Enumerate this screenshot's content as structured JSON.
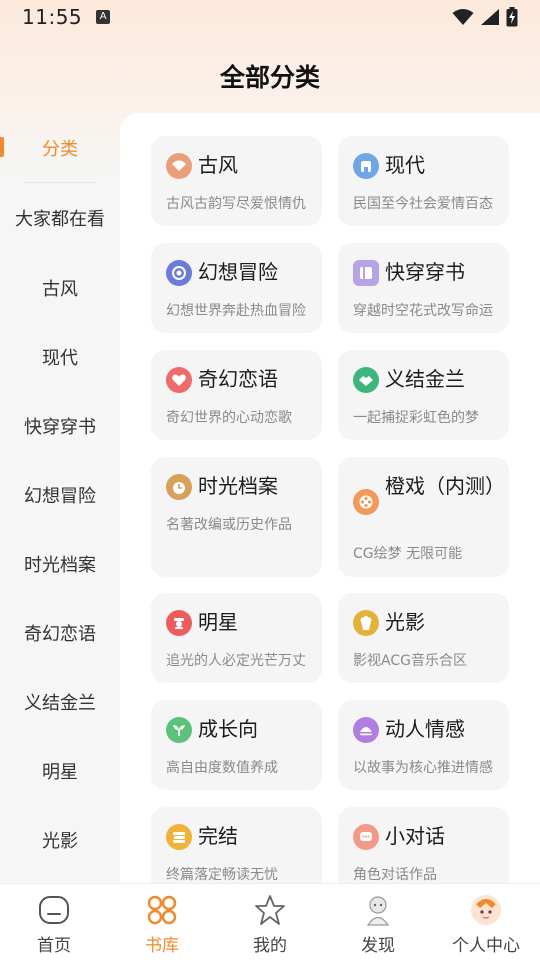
{
  "status_bar": {
    "time": "11:55",
    "notif_badge": "A"
  },
  "header": {
    "title": "全部分类"
  },
  "sidebar": {
    "items": [
      {
        "label": "分类"
      },
      {
        "label": "大家都在看"
      },
      {
        "label": "古风"
      },
      {
        "label": "现代"
      },
      {
        "label": "快穿穿书"
      },
      {
        "label": "幻想冒险"
      },
      {
        "label": "时光档案"
      },
      {
        "label": "奇幻恋语"
      },
      {
        "label": "义结金兰"
      },
      {
        "label": "明星"
      },
      {
        "label": "光影"
      }
    ]
  },
  "categories": [
    {
      "title": "古风",
      "desc": "古风古韵写尽爱恨情仇",
      "icon": "fan-icon",
      "color": "#e9a07a"
    },
    {
      "title": "现代",
      "desc": "民国至今社会爱情百态",
      "icon": "building-icon",
      "color": "#6fa6e6"
    },
    {
      "title": "幻想冒险",
      "desc": "幻想世界奔赴热血冒险",
      "icon": "portal-icon",
      "color": "#6c7bd9"
    },
    {
      "title": "快穿穿书",
      "desc": "穿越时空花式改写命运",
      "icon": "book-icon",
      "color": "#b8a3e6"
    },
    {
      "title": "奇幻恋语",
      "desc": "奇幻世界的心动恋歌",
      "icon": "heart-icon",
      "color": "#ee6b6b"
    },
    {
      "title": "义结金兰",
      "desc": "一起捕捉彩虹色的梦",
      "icon": "handshake-icon",
      "color": "#3fb57e"
    },
    {
      "title": "时光档案",
      "desc": "名著改编或历史作品",
      "icon": "clock-icon",
      "color": "#d9a05c"
    },
    {
      "title": "橙戏（内测）",
      "desc": "CG绘梦 无限可能",
      "icon": "film-reel-icon",
      "color": "#ef9a5a"
    },
    {
      "title": "明星",
      "desc": "追光的人必定光芒万丈",
      "icon": "star-person-icon",
      "color": "#ee5d5d"
    },
    {
      "title": "光影",
      "desc": "影视ACG音乐合区",
      "icon": "popcorn-icon",
      "color": "#e2b23a"
    },
    {
      "title": "成长向",
      "desc": "高自由度数值养成",
      "icon": "sprout-icon",
      "color": "#5cc27a"
    },
    {
      "title": "动人情感",
      "desc": "以故事为核心推进情感",
      "icon": "sunset-icon",
      "color": "#b07ee0"
    },
    {
      "title": "完结",
      "desc": "终篇落定畅读无忧",
      "icon": "books-stack-icon",
      "color": "#f0b23a"
    },
    {
      "title": "小对话",
      "desc": "角色对话作品",
      "icon": "chat-bubble-icon",
      "color": "#f29a8a"
    }
  ],
  "bottom_nav": [
    {
      "label": "首页",
      "icon": "home-icon"
    },
    {
      "label": "书库",
      "icon": "library-grid-icon"
    },
    {
      "label": "我的",
      "icon": "star-icon"
    },
    {
      "label": "发现",
      "icon": "discover-character-icon"
    },
    {
      "label": "个人中心",
      "icon": "avatar-icon"
    }
  ],
  "colors": {
    "accent": "#f08a2c",
    "card_bg": "#f5f5f5",
    "desc": "#8a8a8a"
  }
}
